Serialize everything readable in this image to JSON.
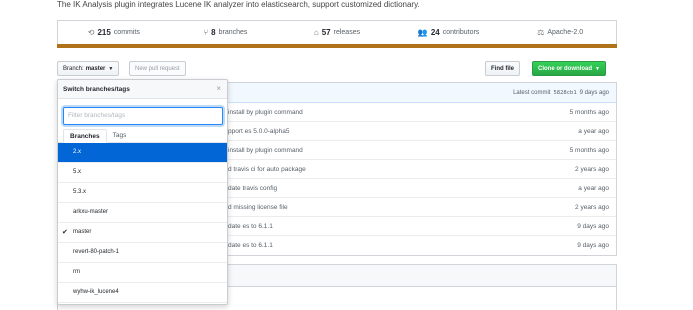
{
  "repo": {
    "description": "The IK Analysis plugin integrates Lucene IK analyzer into elasticsearch, support customized dictionary."
  },
  "stats": [
    {
      "icon": "commits-icon",
      "glyph": "⟲",
      "count": "215",
      "label": "commits"
    },
    {
      "icon": "branch-icon",
      "glyph": "⑂",
      "count": "8",
      "label": "branches"
    },
    {
      "icon": "tag-icon",
      "glyph": "⌂",
      "count": "57",
      "label": "releases"
    },
    {
      "icon": "contributors-icon",
      "glyph": "👥",
      "count": "24",
      "label": "contributors"
    },
    {
      "icon": "license-icon",
      "glyph": "⚖",
      "count": "",
      "label": "Apache-2.0"
    }
  ],
  "colors": {
    "language_bar": "#b07219",
    "accent": "#0366d6",
    "clone_green": "#28a745"
  },
  "toolbar": {
    "branch_prefix": "Branch:",
    "branch_name": "master",
    "new_pr": "New pull request",
    "find_file": "Find file",
    "clone": "Clone or download"
  },
  "latest_commit": {
    "label": "Latest commit",
    "sha": "5828cb1",
    "age": "9 days ago"
  },
  "files": [
    {
      "message": "install by plugin command",
      "age": "5 months ago"
    },
    {
      "message": "pport es 5.0.0-alpha5",
      "age": "a year ago"
    },
    {
      "message": "install by plugin command",
      "age": "5 months ago"
    },
    {
      "message": "d travis ci for auto package",
      "age": "2 years ago"
    },
    {
      "message": "date travis config",
      "age": "a year ago"
    },
    {
      "message": "d missing license file",
      "age": "2 years ago"
    },
    {
      "message": "date es to 6.1.1",
      "age": "9 days ago"
    },
    {
      "message": "date es to 6.1.1",
      "age": "9 days ago"
    }
  ],
  "branch_menu": {
    "title": "Switch branches/tags",
    "close": "×",
    "filter_placeholder": "Filter branches/tags",
    "tabs": [
      "Branches",
      "Tags"
    ],
    "items": [
      {
        "name": "2.x",
        "selected": true,
        "checked": false
      },
      {
        "name": "5.x",
        "selected": false,
        "checked": false
      },
      {
        "name": "5.3.x",
        "selected": false,
        "checked": false
      },
      {
        "name": "arkxu-master",
        "selected": false,
        "checked": false
      },
      {
        "name": "master",
        "selected": false,
        "checked": true
      },
      {
        "name": "revert-80-patch-1",
        "selected": false,
        "checked": false
      },
      {
        "name": "rm",
        "selected": false,
        "checked": false
      },
      {
        "name": "wyhw-ik_lucene4",
        "selected": false,
        "checked": false
      }
    ]
  }
}
